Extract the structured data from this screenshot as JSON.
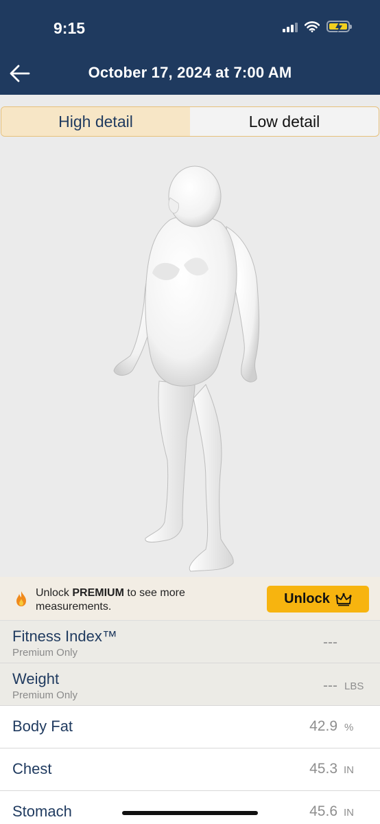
{
  "status_bar": {
    "time": "9:15"
  },
  "header": {
    "title": "October 17, 2024 at 7:00 AM"
  },
  "detail_toggle": {
    "high": "High detail",
    "low": "Low detail"
  },
  "premium_banner": {
    "prefix": "Unlock ",
    "bold": "PREMIUM",
    "suffix": " to see more measurements.",
    "button_label": "Unlock"
  },
  "measurements": [
    {
      "label": "Fitness Index™",
      "sublabel": "Premium Only",
      "value": "---",
      "unit": ""
    },
    {
      "label": "Weight",
      "sublabel": "Premium Only",
      "value": "---",
      "unit": "LBS"
    },
    {
      "label": "Body Fat",
      "sublabel": "",
      "value": "42.9",
      "unit": "%"
    },
    {
      "label": "Chest",
      "sublabel": "",
      "value": "45.3",
      "unit": "IN"
    },
    {
      "label": "Stomach",
      "sublabel": "",
      "value": "45.6",
      "unit": "IN"
    }
  ],
  "colors": {
    "header": "#1f3a5f",
    "accent": "#f7b40f",
    "toggle_active": "#f7e6c6"
  }
}
